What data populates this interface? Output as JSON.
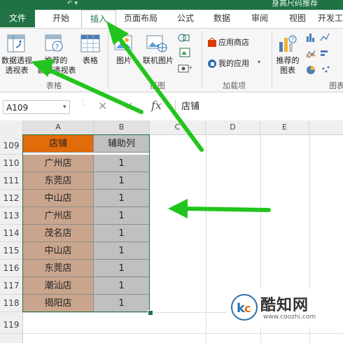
{
  "window": {
    "title_partial": "身高尺码推荐"
  },
  "tabs": [
    "文件",
    "开始",
    "插入",
    "页面布局",
    "公式",
    "数据",
    "审阅",
    "视图",
    "开发工"
  ],
  "ribbon": {
    "buttons": {
      "pivot_table": "数据透视表",
      "recommended_pivot": "推荐的数据透视表",
      "table": "表格",
      "pictures": "图片",
      "online_pictures": "联机图片",
      "app_store": "应用商店",
      "my_apps": "我的应用",
      "recommended_charts": "推荐的图表"
    },
    "groups": {
      "tables": "表格",
      "illustrations": "插图",
      "addins": "加载项",
      "charts": "图表"
    }
  },
  "formula_bar": {
    "name_box": "A109",
    "fx": "fx",
    "content": "店铺"
  },
  "columns": [
    "A",
    "B",
    "C",
    "D",
    "E"
  ],
  "rows": [
    "109",
    "110",
    "111",
    "112",
    "113",
    "114",
    "115",
    "116",
    "117",
    "118",
    "119"
  ],
  "table": {
    "headers": [
      "店铺",
      "辅助列"
    ],
    "rows": [
      [
        "广州店",
        "1"
      ],
      [
        "东莞店",
        "1"
      ],
      [
        "中山店",
        "1"
      ],
      [
        "广州店",
        "1"
      ],
      [
        "茂名店",
        "1"
      ],
      [
        "中山店",
        "1"
      ],
      [
        "东莞店",
        "1"
      ],
      [
        "潮汕店",
        "1"
      ],
      [
        "揭阳店",
        "1"
      ]
    ]
  },
  "watermark": {
    "brand": "酷知网",
    "url": "www.coozhi.com"
  },
  "colors": {
    "excel_green": "#217346",
    "header_orange": "#e26b0a",
    "cell_tan": "#c9a58d",
    "cell_gray": "#c0c0c0",
    "arrow_green": "#22c51d"
  }
}
